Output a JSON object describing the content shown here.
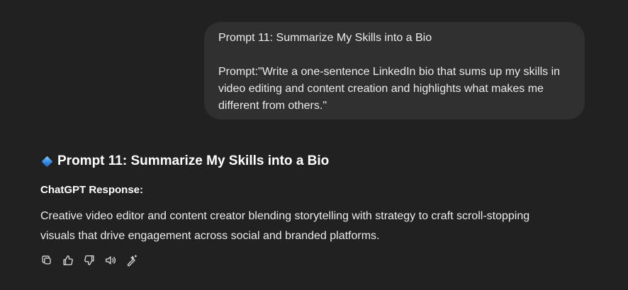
{
  "user_message": {
    "line1": "Prompt 11: Summarize My Skills into a Bio",
    "line2": "Prompt:\"Write a one-sentence LinkedIn bio that sums up my skills in video editing and content creation and highlights what makes me different from others.\""
  },
  "assistant_message": {
    "heading": "Prompt 11: Summarize My Skills into a Bio",
    "label": "ChatGPT Response:",
    "body": "Creative video editor and content creator blending storytelling with strategy to craft scroll-stopping visuals that drive engagement across social and branded platforms."
  },
  "actions": [
    {
      "icon": "copy-icon"
    },
    {
      "icon": "thumbs-up-icon"
    },
    {
      "icon": "thumbs-down-icon"
    },
    {
      "icon": "speaker-icon"
    },
    {
      "icon": "edit-wand-icon"
    }
  ],
  "colors": {
    "background": "#212121",
    "bubble": "#303030",
    "text": "#ececec",
    "icon": "#cdcdcd"
  }
}
